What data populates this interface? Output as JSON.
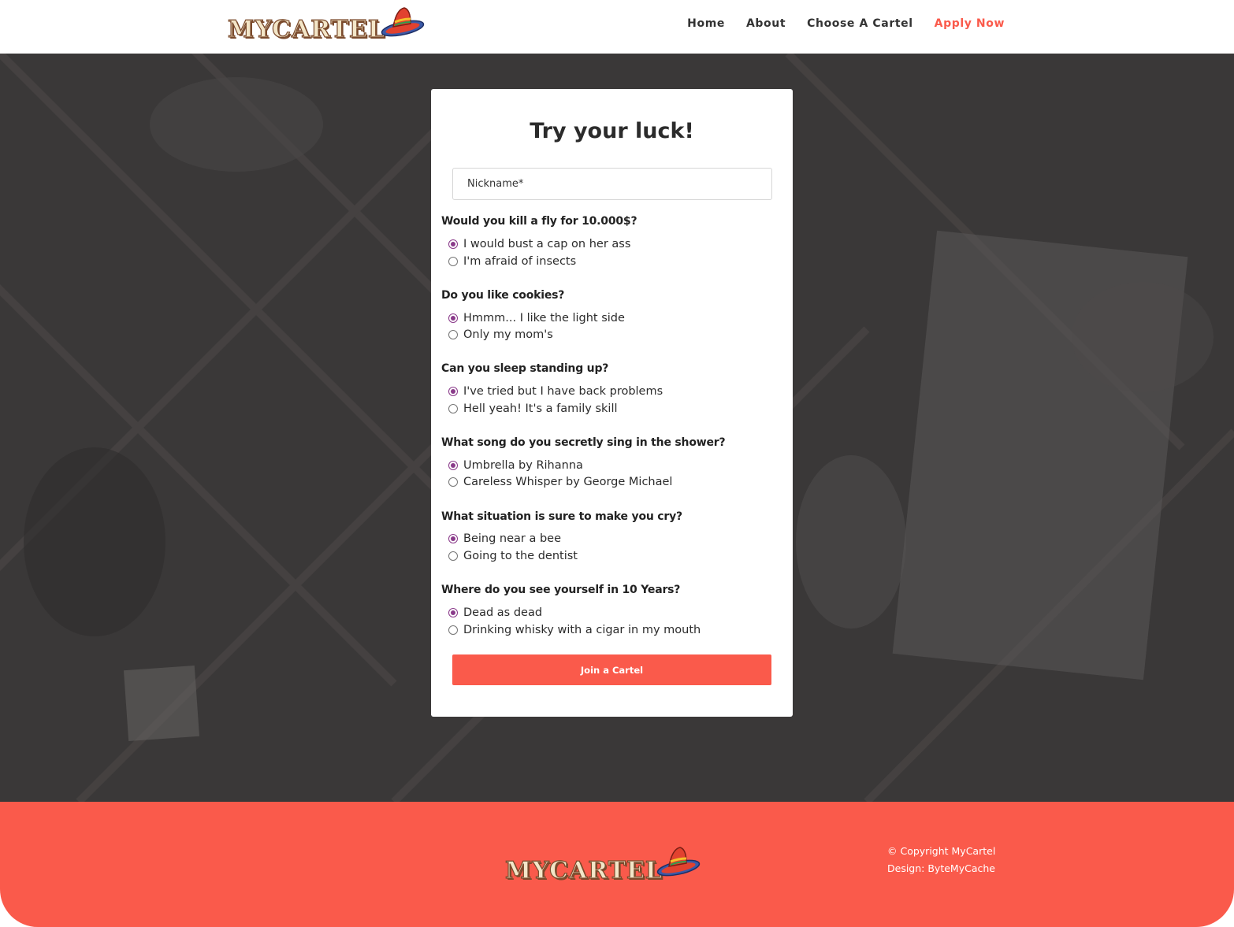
{
  "header": {
    "logo_text": "MYCARTEL",
    "nav": [
      {
        "label": "Home"
      },
      {
        "label": "About"
      },
      {
        "label": "Choose A Cartel"
      },
      {
        "label": "Apply Now",
        "active": true
      }
    ]
  },
  "form": {
    "title": "Try your luck!",
    "nickname_placeholder": "Nickname*",
    "nickname_value": "",
    "questions": [
      {
        "label": "Would you kill a fly for 10.000$?",
        "options": [
          "I would bust a cap on her ass",
          "I'm afraid of insects"
        ],
        "selected": 0
      },
      {
        "label": "Do you like cookies?",
        "options": [
          "Hmmm... I like the light side",
          "Only my mom's"
        ],
        "selected": 0
      },
      {
        "label": "Can you sleep standing up?",
        "options": [
          "I've tried but I have back problems",
          "Hell yeah! It's a family skill"
        ],
        "selected": 0
      },
      {
        "label": "What song do you secretly sing in the shower?",
        "options": [
          "Umbrella by Rihanna",
          "Careless Whisper by George Michael"
        ],
        "selected": 0
      },
      {
        "label": "What situation is sure to make you cry?",
        "options": [
          "Being near a bee",
          "Going to the dentist"
        ],
        "selected": 0
      },
      {
        "label": "Where do you see yourself in 10 Years?",
        "options": [
          "Dead as dead",
          "Drinking whisky with a cigar in my mouth"
        ],
        "selected": 0
      }
    ],
    "submit_label": "Join a Cartel"
  },
  "footer": {
    "logo_text": "MYCARTEL",
    "copyright": "© Copyright MyCartel",
    "design": "Design: ByteMyCache"
  },
  "colors": {
    "accent": "#fa5a4b",
    "radio_checked": "#8a3a8a",
    "hero_bg": "#3a3838"
  }
}
